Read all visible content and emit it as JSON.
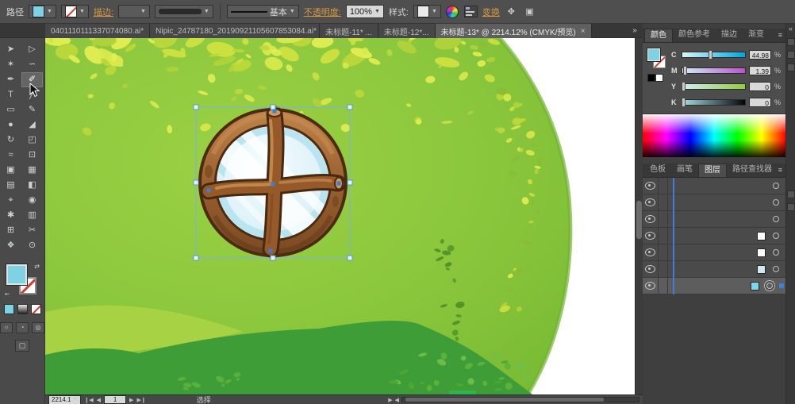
{
  "colors": {
    "fill_teal": "#7fd2e4",
    "selection_blue": "#3b7ed6",
    "link_gold": "#d79a43"
  },
  "control_bar": {
    "object_label": "路径",
    "stroke_link": "描边:",
    "brush_value": "基本",
    "opacity_link": "不透明度:",
    "opacity_value": "100%",
    "style_label": "样式:",
    "transform_link": "变换"
  },
  "tab_bar": {
    "overflow_glyph": "»",
    "close_glyph": "×",
    "tabs": [
      {
        "label": "0401110111337074080.ai*",
        "active": false
      },
      {
        "label": "Nipic_24787180_20190921105607853084.ai*",
        "active": false
      },
      {
        "label": "未标题-11* ...",
        "active": false
      },
      {
        "label": "未标题-12*...",
        "active": false
      },
      {
        "label": "未标题-13* @ 2214.12% (CMYK/预览)",
        "active": true
      }
    ]
  },
  "toolbar": {
    "tools": [
      {
        "name": "selection-tool",
        "glyph": "➤"
      },
      {
        "name": "direct-selection-tool",
        "glyph": "▷"
      },
      {
        "name": "magic-wand-tool",
        "glyph": "✶"
      },
      {
        "name": "lasso-tool",
        "glyph": "∽"
      },
      {
        "name": "pen-tool",
        "glyph": "✒"
      },
      {
        "name": "paintbrush-tool",
        "glyph": "✐",
        "selected": true
      },
      {
        "name": "type-tool",
        "glyph": "T"
      },
      {
        "name": "line-segment-tool",
        "glyph": "╱"
      },
      {
        "name": "rectangle-tool",
        "glyph": "▭"
      },
      {
        "name": "pencil-tool",
        "glyph": "✎"
      },
      {
        "name": "blob-brush-tool",
        "glyph": "●"
      },
      {
        "name": "eraser-tool",
        "glyph": "◢"
      },
      {
        "name": "rotate-tool",
        "glyph": "↻"
      },
      {
        "name": "scale-tool",
        "glyph": "◰"
      },
      {
        "name": "width-tool",
        "glyph": "≈"
      },
      {
        "name": "free-transform-tool",
        "glyph": "⊡"
      },
      {
        "name": "shape-builder-tool",
        "glyph": "▣"
      },
      {
        "name": "perspective-grid-tool",
        "glyph": "▦"
      },
      {
        "name": "mesh-tool",
        "glyph": "▤"
      },
      {
        "name": "gradient-tool",
        "glyph": "◧"
      },
      {
        "name": "eyedropper-tool",
        "glyph": "⌖"
      },
      {
        "name": "blend-tool",
        "glyph": "◉"
      },
      {
        "name": "symbol-sprayer-tool",
        "glyph": "✱"
      },
      {
        "name": "graph-tool",
        "glyph": "▥"
      },
      {
        "name": "artboard-tool",
        "glyph": "⊞"
      },
      {
        "name": "slice-tool",
        "glyph": "✂"
      },
      {
        "name": "hand-tool",
        "glyph": "❖"
      },
      {
        "name": "zoom-tool",
        "glyph": "⊙"
      }
    ]
  },
  "color_panel": {
    "menu_glyph": "≡",
    "tabs": [
      {
        "label": "颜色",
        "active": true
      },
      {
        "label": "颜色参考",
        "active": false
      },
      {
        "label": "描边",
        "active": false
      },
      {
        "label": "渐变",
        "active": false
      }
    ],
    "channels": [
      {
        "label": "C",
        "value": "44.98",
        "unit": "%",
        "pos": 45,
        "track": "cyan"
      },
      {
        "label": "M",
        "value": "1.39",
        "unit": "%",
        "pos": 5,
        "track": "magenta"
      },
      {
        "label": "Y",
        "value": "0",
        "unit": "%",
        "pos": 2,
        "track": "yellow"
      },
      {
        "label": "K",
        "value": "0",
        "unit": "%",
        "pos": 2,
        "track": "black"
      }
    ]
  },
  "layers_panel": {
    "menu_glyph": "≡",
    "tabs": [
      {
        "label": "色板",
        "active": false
      },
      {
        "label": "画笔",
        "active": false
      },
      {
        "label": "图层",
        "active": true
      },
      {
        "label": "路径查找器",
        "active": false
      }
    ],
    "rows": [
      {
        "swatch": null,
        "target": "single",
        "selected": false
      },
      {
        "swatch": null,
        "target": "single",
        "selected": false
      },
      {
        "swatch": null,
        "target": "single",
        "selected": false
      },
      {
        "swatch": "#ffffff",
        "target": "single",
        "selected": false
      },
      {
        "swatch": "#ffffff",
        "target": "single",
        "selected": false
      },
      {
        "swatch": "#cfe9f3",
        "target": "single",
        "selected": false
      },
      {
        "swatch": "#7fd6e8",
        "target": "double",
        "selected": true
      }
    ]
  },
  "status_bar": {
    "zoom": "2214.1",
    "artboard": "1",
    "status": "选择"
  },
  "dock": {
    "expand_glyph": "«"
  }
}
